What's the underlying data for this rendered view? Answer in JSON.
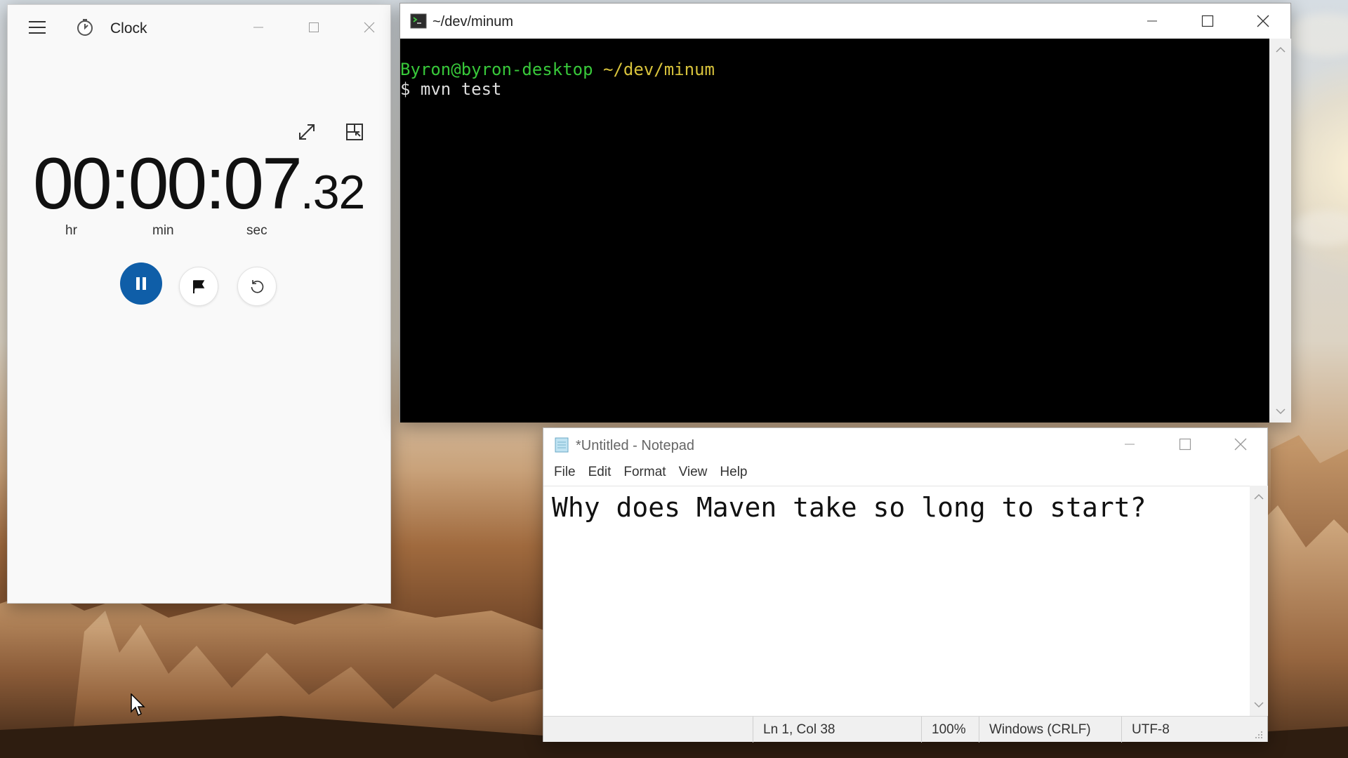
{
  "clock": {
    "title": "Clock",
    "time_main": "00:00:07",
    "time_frac": ".32",
    "units": {
      "hr": "hr",
      "min": "min",
      "sec": "sec"
    },
    "buttons": {
      "pause_icon": "pause-icon",
      "lap_icon": "flag-icon",
      "reset_icon": "reset-icon"
    },
    "accent": "#0f5ea8"
  },
  "terminal": {
    "title": "~/dev/minum",
    "prompt_user": "Byron@byron-desktop",
    "prompt_path": "~/dev/minum",
    "command_line": "$ mvn test",
    "colors": {
      "user": "#38c83a",
      "path": "#d8c33c",
      "background": "#000000"
    }
  },
  "notepad": {
    "title": "*Untitled - Notepad",
    "menu": [
      "File",
      "Edit",
      "Format",
      "View",
      "Help"
    ],
    "content": "Why does Maven take so long to start?",
    "status": {
      "position": "Ln 1, Col 38",
      "zoom": "100%",
      "line_ending": "Windows (CRLF)",
      "encoding": "UTF-8"
    }
  }
}
